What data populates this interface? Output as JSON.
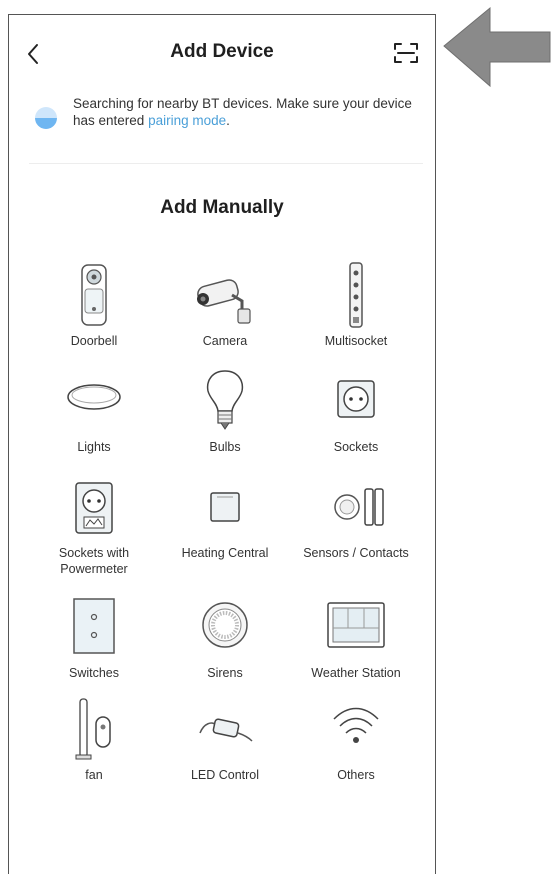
{
  "header": {
    "title": "Add Device"
  },
  "banner": {
    "text": "Searching for nearby BT devices. Make sure your device has entered ",
    "link": "pairing mode",
    "suffix": "."
  },
  "section_title": "Add Manually",
  "devices": [
    {
      "label": "Doorbell",
      "icon": "doorbell-icon"
    },
    {
      "label": "Camera",
      "icon": "camera-icon"
    },
    {
      "label": "Multisocket",
      "icon": "multisocket-icon"
    },
    {
      "label": "Lights",
      "icon": "ceiling-light-icon"
    },
    {
      "label": "Bulbs",
      "icon": "bulb-icon"
    },
    {
      "label": "Sockets",
      "icon": "socket-icon"
    },
    {
      "label": "Sockets with Powermeter",
      "icon": "socket-powermeter-icon"
    },
    {
      "label": "Heating Central",
      "icon": "heating-central-icon"
    },
    {
      "label": "Sensors / Contacts",
      "icon": "sensor-contact-icon"
    },
    {
      "label": "Switches",
      "icon": "switch-icon"
    },
    {
      "label": "Sirens",
      "icon": "siren-icon"
    },
    {
      "label": "Weather Station",
      "icon": "weather-station-icon"
    },
    {
      "label": "fan",
      "icon": "fan-icon"
    },
    {
      "label": "LED Control",
      "icon": "led-control-icon"
    },
    {
      "label": "Others",
      "icon": "wifi-others-icon"
    }
  ],
  "colors": {
    "link": "#4a9fd8",
    "arrow": "#8a8a8a",
    "spinner": "#6fb6f1"
  }
}
